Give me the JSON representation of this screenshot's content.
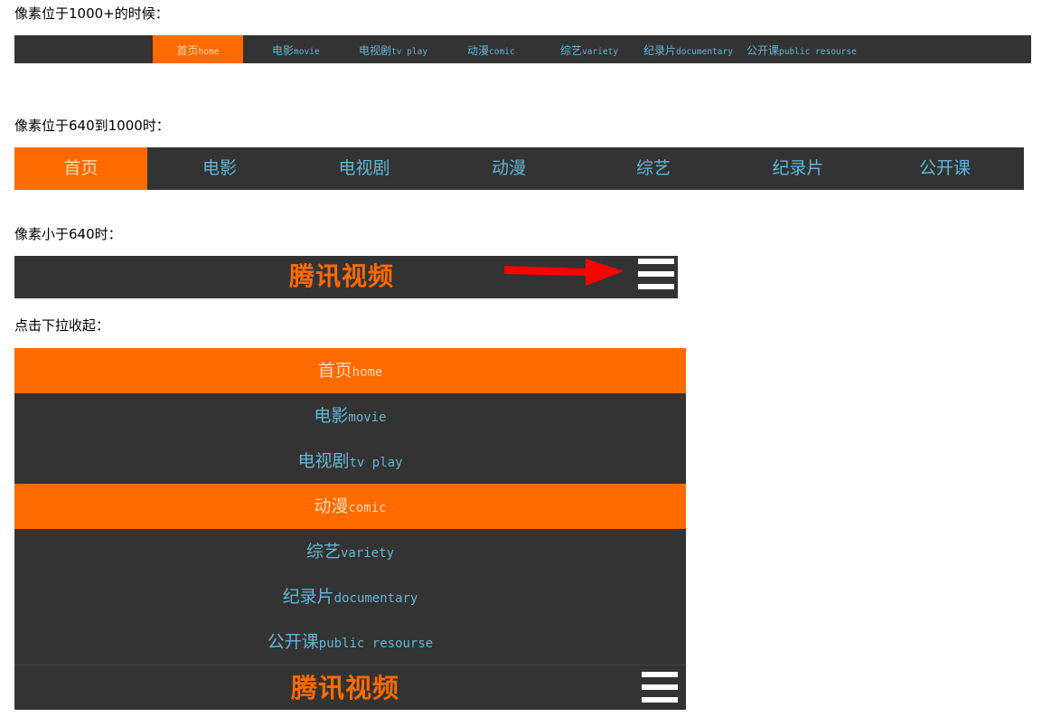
{
  "captions": {
    "wide": "像素位于1000+的时候：",
    "medium": "像素位于640到1000时：",
    "small": "像素小于640时：",
    "expanded": "点击下拉收起："
  },
  "wide_nav": {
    "items": [
      {
        "cn": "首页",
        "en": "home"
      },
      {
        "cn": "电影",
        "en": "movie"
      },
      {
        "cn": "电视剧",
        "en": "tv play"
      },
      {
        "cn": "动漫",
        "en": "comic"
      },
      {
        "cn": "综艺",
        "en": "variety"
      },
      {
        "cn": "纪录片",
        "en": "documentary"
      },
      {
        "cn": "公开课",
        "en": "public resourse"
      }
    ]
  },
  "medium_nav": {
    "items": [
      "首页",
      "电影",
      "电视剧",
      "动漫",
      "综艺",
      "纪录片",
      "公开课"
    ]
  },
  "small_bar": {
    "brand": "腾讯视频",
    "menu_icon": "hamburger-icon",
    "arrow_icon": "red-arrow-icon"
  },
  "expanded_menu": {
    "items": [
      {
        "cn": "首页",
        "en": "home"
      },
      {
        "cn": "电影",
        "en": "movie"
      },
      {
        "cn": "电视剧",
        "en": "tv play"
      },
      {
        "cn": "动漫",
        "en": "comic"
      },
      {
        "cn": "综艺",
        "en": "variety"
      },
      {
        "cn": "纪录片",
        "en": "documentary"
      },
      {
        "cn": "公开课",
        "en": "public resourse"
      }
    ],
    "brand": "腾讯视频"
  },
  "colors": {
    "bar_bg": "#333333",
    "active_bg": "#ff6a00",
    "link": "#62b6d6",
    "brand": "#ff6a00",
    "arrow": "#ff0000"
  }
}
